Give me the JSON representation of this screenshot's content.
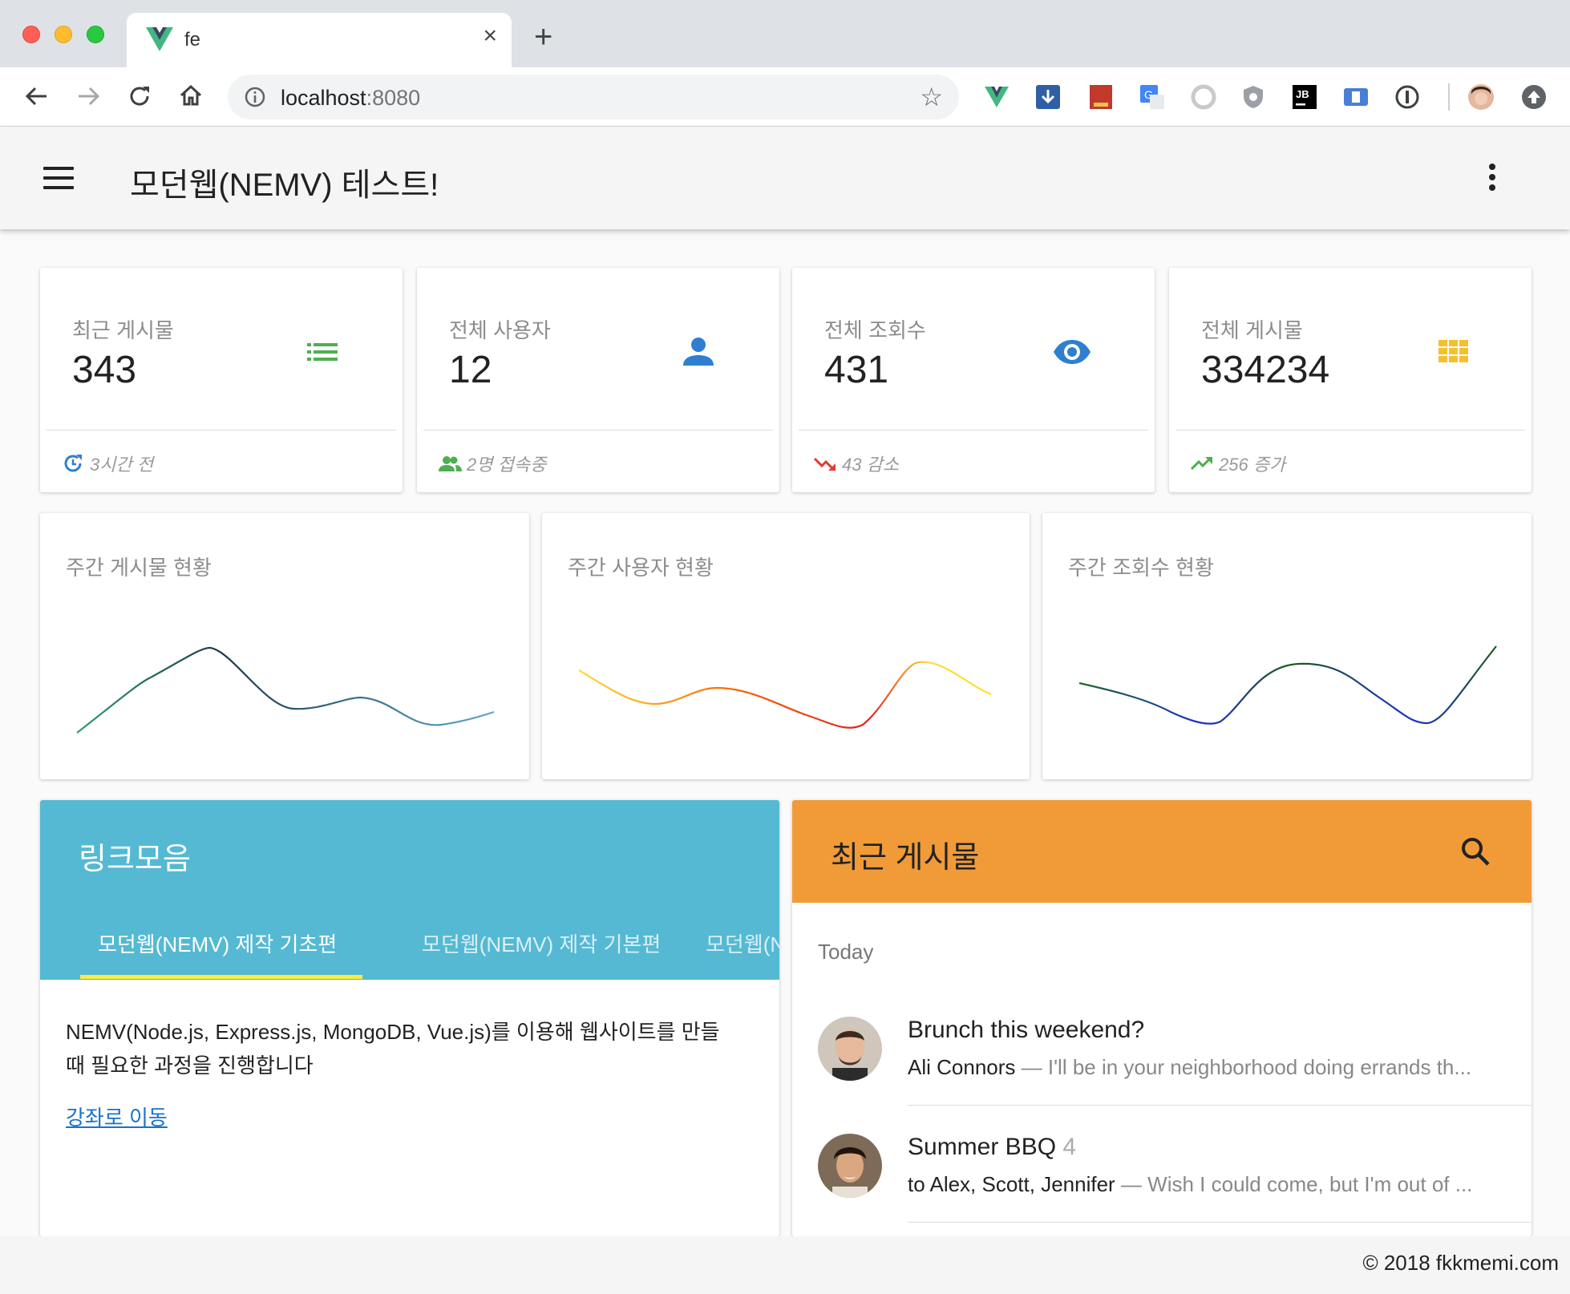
{
  "browser": {
    "tab_title": "fe",
    "tab_close": "×",
    "new_tab": "+",
    "url_host": "localhost",
    "url_port": ":8080",
    "bookmark_star": "☆"
  },
  "appbar": {
    "title": "모던웹(NEMV) 테스트!"
  },
  "stats": [
    {
      "label": "최근 게시물",
      "value": "343",
      "footer": "3시간 전",
      "icon": "list-icon",
      "footer_icon": "refresh-icon",
      "accent": "#4caf50"
    },
    {
      "label": "전체 사용자",
      "value": "12",
      "footer": "2명 접속중",
      "icon": "person-icon",
      "footer_icon": "group-icon",
      "accent": "#2f7fd0"
    },
    {
      "label": "전체 조회수",
      "value": "431",
      "footer": "43 감소",
      "icon": "eye-icon",
      "footer_icon": "trending-down-icon",
      "accent": "#2f7fd0"
    },
    {
      "label": "전체 게시물",
      "value": "334234",
      "footer": "256 증가",
      "icon": "apps-grid-icon",
      "footer_icon": "trending-up-icon",
      "accent": "#f4c12c"
    }
  ],
  "sparklines": [
    {
      "title": "주간 게시물 현황",
      "colors": [
        "#2e9e6b",
        "#1b3a4a",
        "#5fa8c8"
      ]
    },
    {
      "title": "주간 사용자 현황",
      "colors": [
        "#ffdd33",
        "#ff6a00",
        "#e02020"
      ]
    },
    {
      "title": "주간 조회수 현황",
      "colors": [
        "#1e6b2a",
        "#1c2fcf",
        "#1c5a1c"
      ]
    }
  ],
  "links": {
    "title": "링크모음",
    "tabs": [
      "모던웹(NEMV) 제작 기초편",
      "모던웹(NEMV) 제작 기본편",
      "모던웹(N"
    ],
    "description_line1": "NEMV(Node.js, Express.js, MongoDB, Vue.js)를 이용해 웹사이트를 만들",
    "description_line2": "때 필요한 과정을 진행합니다",
    "anchor": "강좌로 이동",
    "header_color": "#55b9d3",
    "underline_color": "#ffeb3b"
  },
  "posts": {
    "title": "최근 게시물",
    "subheader": "Today",
    "header_color": "#f19b38",
    "items": [
      {
        "title": "Brunch this weekend?",
        "count": "",
        "sender": "Ali Connors",
        "dash": " — ",
        "preview": "I'll be in your neighborhood doing errands th..."
      },
      {
        "title": "Summer BBQ ",
        "count": "4",
        "sender": "to Alex, Scott, Jennifer",
        "dash": " — ",
        "preview": "Wish I could come, but I'm out of ..."
      }
    ]
  },
  "footer": {
    "text": "© 2018 fkkmemi.com"
  }
}
